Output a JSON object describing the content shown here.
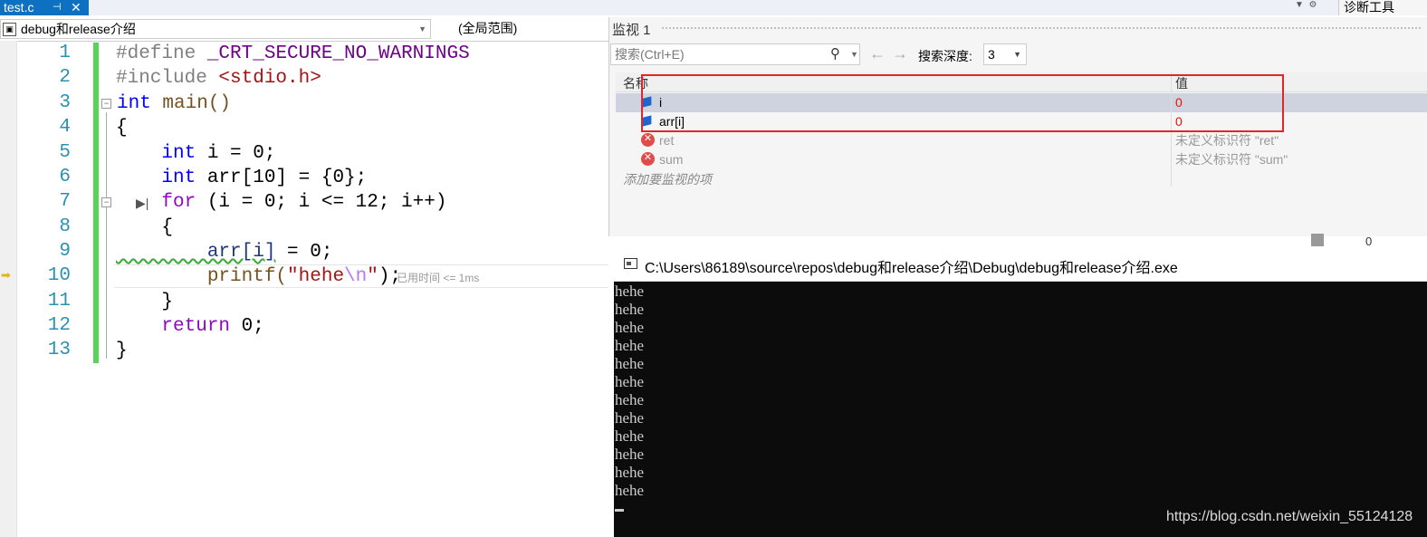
{
  "tab": {
    "title": "test.c",
    "pin_glyph": "⊣",
    "close_glyph": "✕"
  },
  "diag_tab": {
    "label": "诊断工具"
  },
  "nav": {
    "project": "debug和release介绍",
    "scope": "(全局范围)"
  },
  "editor": {
    "line_numbers": [
      "1",
      "2",
      "3",
      "4",
      "5",
      "6",
      "7",
      "8",
      "9",
      "10",
      "11",
      "12",
      "13"
    ],
    "elapsed": "已用时间 <= 1ms"
  },
  "code_text": {
    "l1_a": "#define ",
    "l1_b": "_CRT_SECURE_NO_WARNINGS",
    "l2_a": "#include ",
    "l2_b": "<stdio.h>",
    "l3_a": "int",
    "l3_b": " main()",
    "l4": "{",
    "l5_a": "    int",
    "l5_b": " i = 0;",
    "l6_a": "    int",
    "l6_b": " arr[10] = {0};",
    "l7_a": "    for",
    "l7_b": " (i = 0; i <= 12; i++)",
    "l8": "    {",
    "l9_a": "        arr[i]",
    "l9_b": " = 0;",
    "l10_a": "        printf(",
    "l10_b": "\"hehe",
    "l10_c": "\\n",
    "l10_d": "\"",
    "l10_e": ");",
    "l11": "    }",
    "l12_a": "    return",
    "l12_b": " 0;",
    "l13": "}"
  },
  "watch": {
    "title": "监视 1",
    "search_placeholder": "搜索(Ctrl+E)",
    "depth_label": "搜索深度:",
    "depth_value": "3",
    "col_name": "名称",
    "col_value": "值",
    "rows": [
      {
        "name": "i",
        "value": "0",
        "kind": "var"
      },
      {
        "name": "arr[i]",
        "value": "0",
        "kind": "var"
      },
      {
        "name": "ret",
        "value": "未定义标识符 \"ret\"",
        "kind": "error"
      },
      {
        "name": "sum",
        "value": "未定义标识符 \"sum\"",
        "kind": "error"
      }
    ],
    "add_item": "添加要监视的项",
    "scroll_value": "0"
  },
  "console": {
    "path": "C:\\Users\\86189\\source\\repos\\debug和release介绍\\Debug\\debug和release介绍.exe",
    "lines": [
      "hehe",
      "hehe",
      "hehe",
      "hehe",
      "hehe",
      "hehe",
      "hehe",
      "hehe",
      "hehe",
      "hehe",
      "hehe",
      "hehe"
    ]
  },
  "watermark": "https://blog.csdn.net/weixin_55124128",
  "colors": {
    "keyword": "#0000ff",
    "string": "#a31515",
    "line_number": "#2b91af",
    "change_bar": "#57d457",
    "highlight_box": "#e0262a",
    "value_red": "#e51400"
  }
}
